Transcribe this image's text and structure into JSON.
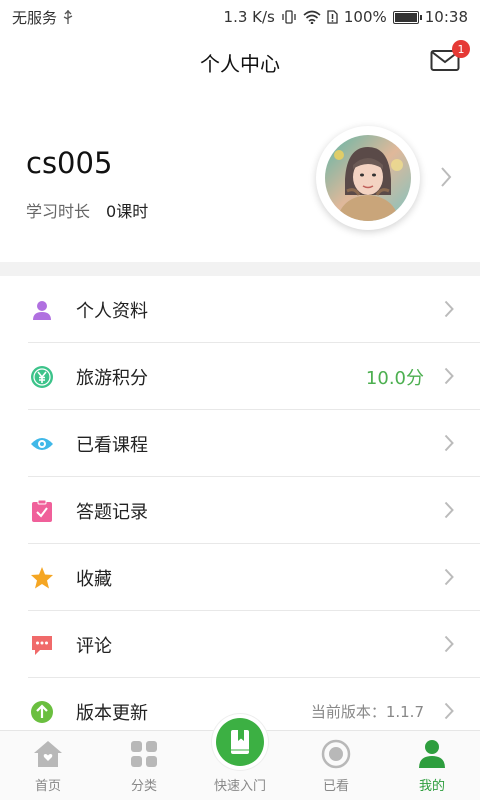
{
  "status_bar": {
    "carrier": "无服务",
    "speed": "1.3 K/s",
    "battery": "100%",
    "battery_level": 1.0,
    "time": "10:38"
  },
  "header": {
    "title": "个人中心",
    "mail_badge": "1"
  },
  "profile": {
    "username": "cs005",
    "study_label": "学习时长",
    "study_value": "0课时"
  },
  "menu": [
    {
      "label": "个人资料",
      "value": "",
      "icon": "person-icon",
      "color": "#b070e0"
    },
    {
      "label": "旅游积分",
      "value": "10.0分",
      "icon": "yuan-icon",
      "color": "#3cc38a"
    },
    {
      "label": "已看课程",
      "value": "",
      "icon": "eye-icon",
      "color": "#40b8e8"
    },
    {
      "label": "答题记录",
      "value": "",
      "icon": "clipboard-check-icon",
      "color": "#f0609a"
    },
    {
      "label": "收藏",
      "value": "",
      "icon": "star-icon",
      "color": "#f5a623"
    },
    {
      "label": "评论",
      "value": "",
      "icon": "comment-icon",
      "color": "#f06a6a"
    },
    {
      "label": "版本更新",
      "value": "当前版本：1.1.7",
      "icon": "upload-arrow-icon",
      "color": "#6abf3f"
    }
  ],
  "bottom_nav": [
    {
      "label": "首页",
      "icon": "home-icon"
    },
    {
      "label": "分类",
      "icon": "grid-icon"
    },
    {
      "label": "快速入门",
      "icon": "book-icon"
    },
    {
      "label": "已看",
      "icon": "record-icon"
    },
    {
      "label": "我的",
      "icon": "user-icon"
    }
  ],
  "colors": {
    "accent": "#3cb043",
    "badge": "#e53935"
  }
}
